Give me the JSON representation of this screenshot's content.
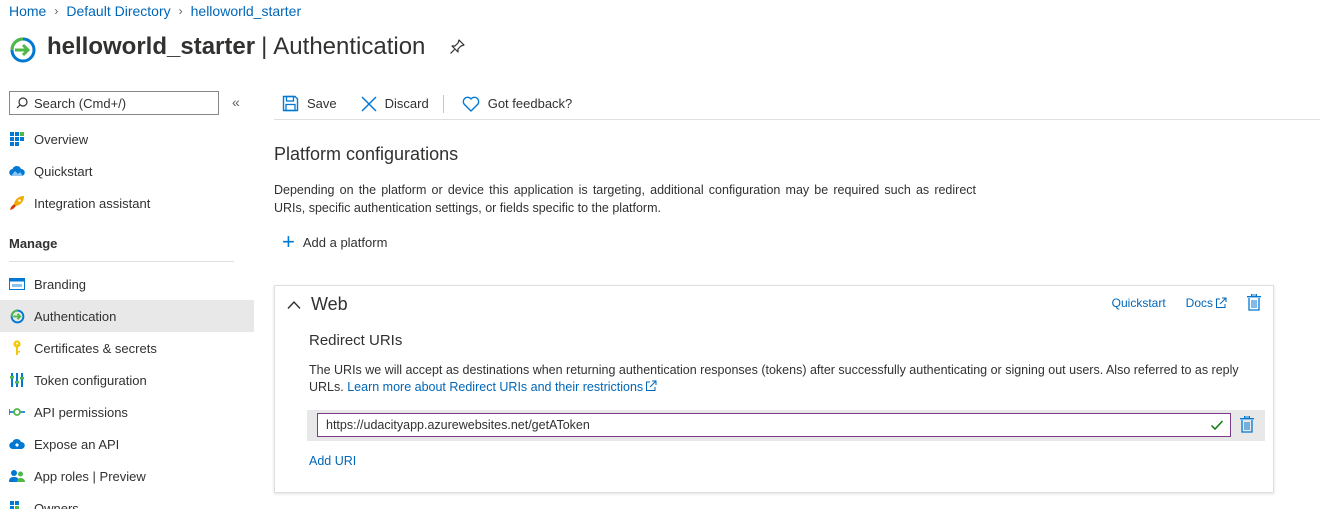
{
  "breadcrumb": [
    {
      "label": "Home"
    },
    {
      "label": "Default Directory"
    },
    {
      "label": "helloworld_starter"
    }
  ],
  "title": {
    "app": "helloworld_starter",
    "separator": "|",
    "page": "Authentication"
  },
  "sidebar": {
    "search_placeholder": "Search (Cmd+/)",
    "collapse_glyph": "«",
    "items_top": [
      {
        "label": "Overview",
        "icon": "overview-grid-icon"
      },
      {
        "label": "Quickstart",
        "icon": "quickstart-cloud-icon"
      },
      {
        "label": "Integration assistant",
        "icon": "rocket-icon"
      }
    ],
    "manage_header": "Manage",
    "items_manage": [
      {
        "label": "Branding",
        "icon": "branding-icon"
      },
      {
        "label": "Authentication",
        "icon": "authentication-icon",
        "active": true
      },
      {
        "label": "Certificates & secrets",
        "icon": "key-icon"
      },
      {
        "label": "Token configuration",
        "icon": "token-bars-icon"
      },
      {
        "label": "API permissions",
        "icon": "api-permissions-icon"
      },
      {
        "label": "Expose an API",
        "icon": "expose-api-cloud-icon"
      },
      {
        "label": "App roles | Preview",
        "icon": "app-roles-icon"
      },
      {
        "label": "Owners",
        "icon": "owners-icon"
      }
    ]
  },
  "toolbar": {
    "save_label": "Save",
    "discard_label": "Discard",
    "feedback_label": "Got feedback?"
  },
  "main": {
    "heading": "Platform configurations",
    "description": "Depending on the platform or device this application is targeting, additional configuration may be required such as redirect URIs, specific authentication settings, or fields specific to the platform.",
    "add_platform_label": "Add a platform"
  },
  "web_card": {
    "title": "Web",
    "quickstart_label": "Quickstart",
    "docs_label": "Docs",
    "redirect_heading": "Redirect URIs",
    "redirect_desc": "The URIs we will accept as destinations when returning authentication responses (tokens) after successfully authenticating or signing out users. Also referred to as reply URLs.",
    "learn_more_label": "Learn more about Redirect URIs and their restrictions",
    "uri_value": "https://udacityapp.azurewebsites.net/getAToken",
    "add_uri_label": "Add URI"
  },
  "colors": {
    "link": "#0067b8",
    "accent": "#0078d4",
    "active_bg": "#e8e8e8",
    "input_border": "#7a3b89",
    "valid_check": "#107c10"
  }
}
